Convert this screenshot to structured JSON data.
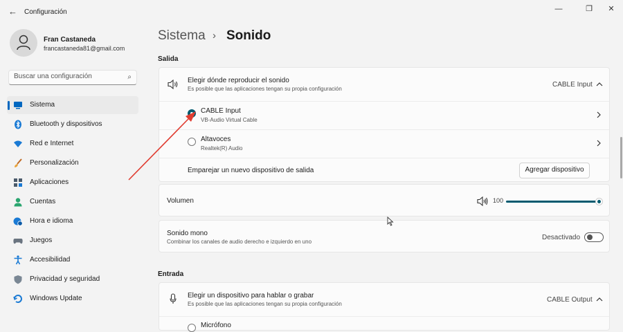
{
  "window": {
    "title": "Configuración",
    "back_icon": "←",
    "minimize_icon": "—",
    "maximize_icon": "❐",
    "close_icon": "✕"
  },
  "profile": {
    "name": "Fran Castaneda",
    "email": "francastaneda81@gmail.com"
  },
  "search": {
    "placeholder": "Buscar una configuración",
    "icon": "⌕"
  },
  "sidebar": {
    "items": [
      {
        "label": "Sistema",
        "icon": "system-icon",
        "active": true
      },
      {
        "label": "Bluetooth y dispositivos",
        "icon": "bluetooth-icon"
      },
      {
        "label": "Red e Internet",
        "icon": "wifi-icon"
      },
      {
        "label": "Personalización",
        "icon": "brush-icon"
      },
      {
        "label": "Aplicaciones",
        "icon": "apps-icon"
      },
      {
        "label": "Cuentas",
        "icon": "account-icon"
      },
      {
        "label": "Hora e idioma",
        "icon": "globe-clock-icon"
      },
      {
        "label": "Juegos",
        "icon": "gamepad-icon"
      },
      {
        "label": "Accesibilidad",
        "icon": "accessibility-icon"
      },
      {
        "label": "Privacidad y seguridad",
        "icon": "shield-icon"
      },
      {
        "label": "Windows Update",
        "icon": "update-icon"
      }
    ]
  },
  "header": {
    "breadcrumb_parent": "Sistema",
    "separator": "›",
    "title": "Sonido"
  },
  "output": {
    "section_label": "Salida",
    "choose": {
      "title": "Elegir dónde reproducir el sonido",
      "subtitle": "Es posible que las aplicaciones tengan su propia configuración",
      "value": "CABLE Input"
    },
    "devices": [
      {
        "name": "CABLE Input",
        "description": "VB-Audio Virtual Cable",
        "selected": true
      },
      {
        "name": "Altavoces",
        "description": "Realtek(R) Audio",
        "selected": false
      }
    ],
    "pair": {
      "label": "Emparejar un nuevo dispositivo de salida",
      "button": "Agregar dispositivo"
    },
    "volume": {
      "label": "Volumen",
      "value": "100",
      "level_percent": 100
    },
    "mono": {
      "title": "Sonido mono",
      "subtitle": "Combinar los canales de audio derecho e izquierdo en uno",
      "state": "Desactivado"
    }
  },
  "input": {
    "section_label": "Entrada",
    "choose": {
      "title": "Elegir un dispositivo para hablar o grabar",
      "subtitle": "Es posible que las aplicaciones tengan su propia configuración",
      "value": "CABLE Output"
    },
    "partial_device": "Micrófono"
  },
  "colors": {
    "accent": "#005a6f",
    "annotation_arrow": "#e03c31",
    "windows_blue": "#0067c0"
  }
}
